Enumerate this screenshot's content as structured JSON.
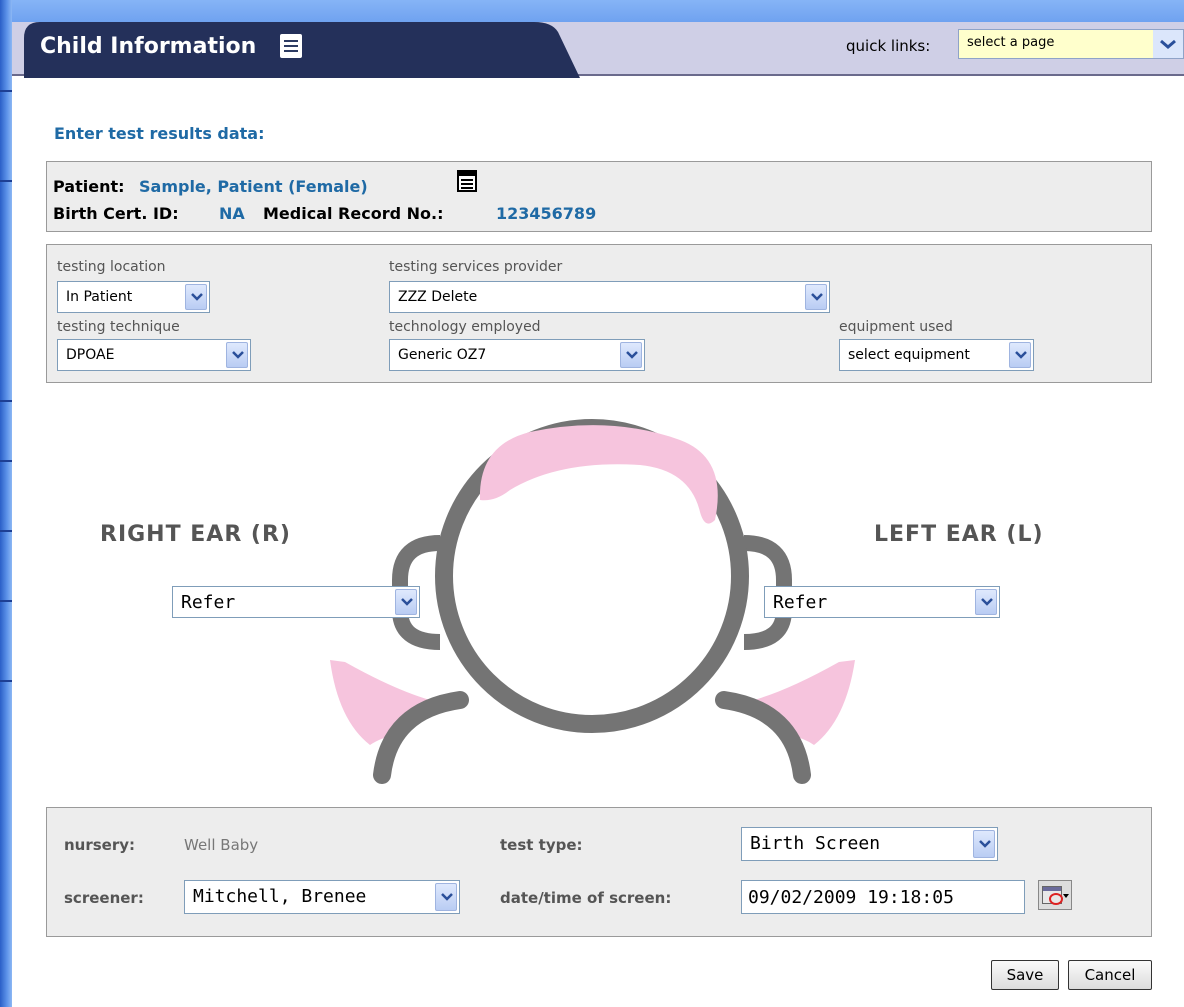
{
  "header": {
    "title": "Child Information",
    "quick_links_label": "quick links:",
    "quick_links_value": "select a page"
  },
  "heading": "Enter test results data:",
  "patient": {
    "patient_label": "Patient:",
    "patient_name": "Sample, Patient (Female)",
    "birth_cert_label": "Birth Cert. ID:",
    "birth_cert_value": "NA",
    "mrn_label": "Medical Record No.:",
    "mrn_value": "123456789"
  },
  "testing": {
    "location_label": "testing location",
    "location_value": "In Patient",
    "provider_label": "testing services provider",
    "provider_value": "ZZZ Delete",
    "technique_label": "testing technique",
    "technique_value": "DPOAE",
    "technology_label": "technology employed",
    "technology_value": "Generic OZ7",
    "equipment_label": "equipment used",
    "equipment_value": "select equipment"
  },
  "ears": {
    "right_label": "RIGHT EAR (R)",
    "right_value": "Refer",
    "left_label": "LEFT EAR (L)",
    "left_value": "Refer"
  },
  "screening": {
    "nursery_label": "nursery:",
    "nursery_value": "Well Baby",
    "test_type_label": "test type:",
    "test_type_value": "Birth Screen",
    "screener_label": "screener:",
    "screener_value": "Mitchell, Brenee",
    "datetime_label": "date/time of screen:",
    "datetime_value": "09/02/2009 19:18:05"
  },
  "actions": {
    "save_label": "Save",
    "cancel_label": "Cancel"
  },
  "colors": {
    "accent_blue": "#1f6aa5",
    "title_tab": "#24305a",
    "hair_pink": "#f6c4dd",
    "face_outline": "#747474"
  }
}
